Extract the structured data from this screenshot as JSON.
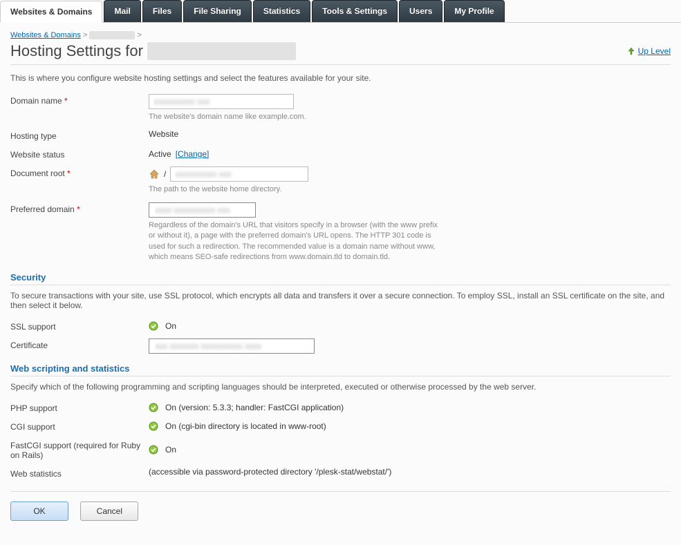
{
  "tabs": [
    {
      "label": "Websites & Domains",
      "active": true
    },
    {
      "label": "Mail"
    },
    {
      "label": "Files"
    },
    {
      "label": "File Sharing"
    },
    {
      "label": "Statistics"
    },
    {
      "label": "Tools & Settings"
    },
    {
      "label": "Users"
    },
    {
      "label": "My Profile"
    }
  ],
  "breadcrumb": {
    "root": "Websites & Domains",
    "sep": ">",
    "current_redacted": "xxxxxxxxxxxx"
  },
  "title_prefix": "Hosting Settings for ",
  "title_domain_redacted": "xxxxxxxxxxxxxxx xxxx",
  "up_level": "Up Level",
  "intro": "This is where you configure website hosting settings and select the features available for your site.",
  "labels": {
    "domain_name": "Domain name",
    "hosting_type": "Hosting type",
    "website_status": "Website status",
    "document_root": "Document root",
    "preferred_domain": "Preferred domain",
    "ssl_support": "SSL support",
    "certificate": "Certificate",
    "php_support": "PHP support",
    "cgi_support": "CGI support",
    "fastcgi_support": "FastCGI support (required for Ruby on Rails)",
    "web_statistics": "Web statistics"
  },
  "values": {
    "domain_name_value_redacted": "xxxxxxxxxx xxx",
    "domain_name_hint": "The website's domain name like example.com.",
    "hosting_type": "Website",
    "website_status": "Active",
    "change_link": "[Change]",
    "docroot_slash": "/",
    "docroot_value_redacted": "xxxxxxxxxx xxx",
    "docroot_hint": "The path to the website home directory.",
    "preferred_value_redacted": "xxxx xxxxxxxxxx xxx",
    "preferred_hint": "Regardless of the domain's URL that visitors specify in a browser (with the www prefix or without it), a page with the preferred domain's URL opens. The HTTP 301 code is used for such a redirection. The recommended value is a domain name without www, which means SEO-safe redirections from www.domain.tld to domain.tld.",
    "on": "On",
    "cert_value_redacted": "xxx xxxxxxx xxxxxxxxxx xxxx",
    "php_detail": "On (version: 5.3.3; handler: FastCGI application)",
    "cgi_detail": "On (cgi-bin directory is located in www-root)",
    "webstat_detail": "(accessible via password-protected directory '/plesk-stat/webstat/')"
  },
  "sections": {
    "security_title": "Security",
    "security_desc": "To secure transactions with your site, use SSL protocol, which encrypts all data and transfers it over a secure connection. To employ SSL, install an SSL certificate on the site, and then select it below.",
    "scripting_title": "Web scripting and statistics",
    "scripting_desc": "Specify which of the following programming and scripting languages should be interpreted, executed or otherwise processed by the web server."
  },
  "buttons": {
    "ok": "OK",
    "cancel": "Cancel"
  }
}
